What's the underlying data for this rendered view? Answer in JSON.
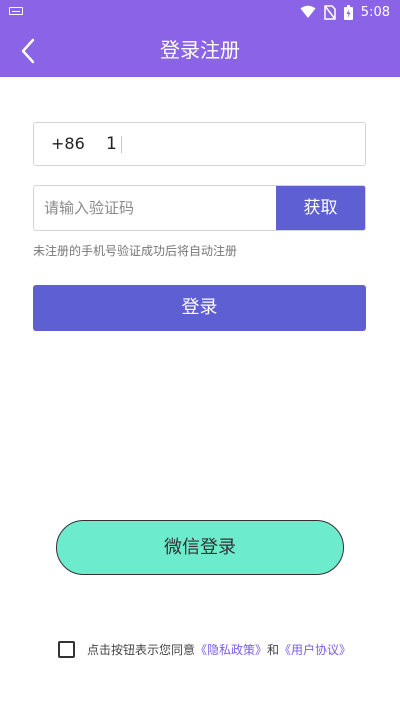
{
  "status_bar": {
    "time": "5:08"
  },
  "header": {
    "title": "登录注册"
  },
  "phone": {
    "country_code": "+86",
    "value": "1"
  },
  "verification": {
    "placeholder": "请输入验证码",
    "get_code_label": "获取"
  },
  "hint": "未注册的手机号验证成功后将自动注册",
  "login_label": "登录",
  "wechat_login_label": "微信登录",
  "agreement": {
    "prefix": "点击按钮表示您同意",
    "privacy_link": "《隐私政策》",
    "conjunction": "和",
    "user_agreement_link": "《用户协议》"
  },
  "colors": {
    "header_bg": "#8a63e7",
    "button_bg": "#5e5fd2",
    "wechat_bg": "#6debcd",
    "link": "#7b5ce6"
  }
}
